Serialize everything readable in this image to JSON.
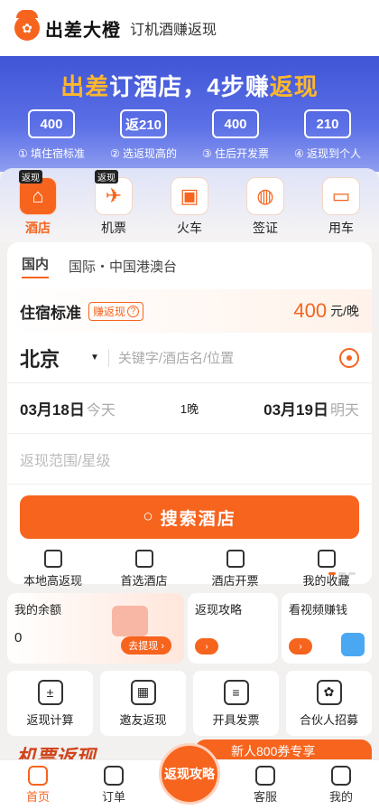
{
  "header": {
    "brand": "出差大橙",
    "slogan": "订机酒赚返现",
    "logo_icon": "orange-logo-icon"
  },
  "banner": {
    "title_a": "出差",
    "title_b": "订酒店，4步赚",
    "title_c": "返现",
    "steps": [
      {
        "icon_text": "400",
        "label": "① 填住宿标准"
      },
      {
        "icon_text": "返210",
        "label": "② 选返现高的"
      },
      {
        "icon_text": "400",
        "label": "③ 住后开发票"
      },
      {
        "icon_text": "210",
        "label": "④ 返现到个人"
      }
    ]
  },
  "categories": [
    {
      "label": "酒店",
      "tag": "返现",
      "icon": "hotel-icon"
    },
    {
      "label": "机票",
      "tag": "返现",
      "icon": "plane-icon"
    },
    {
      "label": "火车",
      "icon": "train-icon"
    },
    {
      "label": "签证",
      "icon": "visa-icon"
    },
    {
      "label": "用车",
      "icon": "car-icon"
    }
  ],
  "booking": {
    "tabs": [
      "国内",
      "国际・中国港澳台"
    ],
    "standard_label": "住宿标准",
    "standard_tag": "赚返现",
    "standard_amount": "400",
    "standard_unit": "元/晚",
    "city": "北京",
    "keyword_placeholder": "关键字/酒店名/位置",
    "checkin_date": "03月18日",
    "checkin_day": "今天",
    "nights": "1晚",
    "checkout_date": "03月19日",
    "checkout_day": "明天",
    "range_placeholder": "返现范围/星级",
    "search_label": "搜索酒店",
    "quick_links": [
      "本地高返现",
      "首选酒店",
      "酒店开票",
      "我的收藏"
    ]
  },
  "promos": {
    "balance_title": "我的余额",
    "balance_value": "0",
    "withdraw_label": "去提现 ›",
    "guide_title": "返现攻略",
    "video_title": "看视频赚钱"
  },
  "tools": [
    "返现计算",
    "邀友返现",
    "开具发票",
    "合伙人招募"
  ],
  "strip": {
    "left": "机票返现",
    "right": "新人800券专享"
  },
  "nav": {
    "items": [
      "首页",
      "订单",
      "客服",
      "我的"
    ],
    "center": "返现攻略"
  },
  "colors": {
    "accent": "#f6641e",
    "banner": "#3f55d6"
  }
}
